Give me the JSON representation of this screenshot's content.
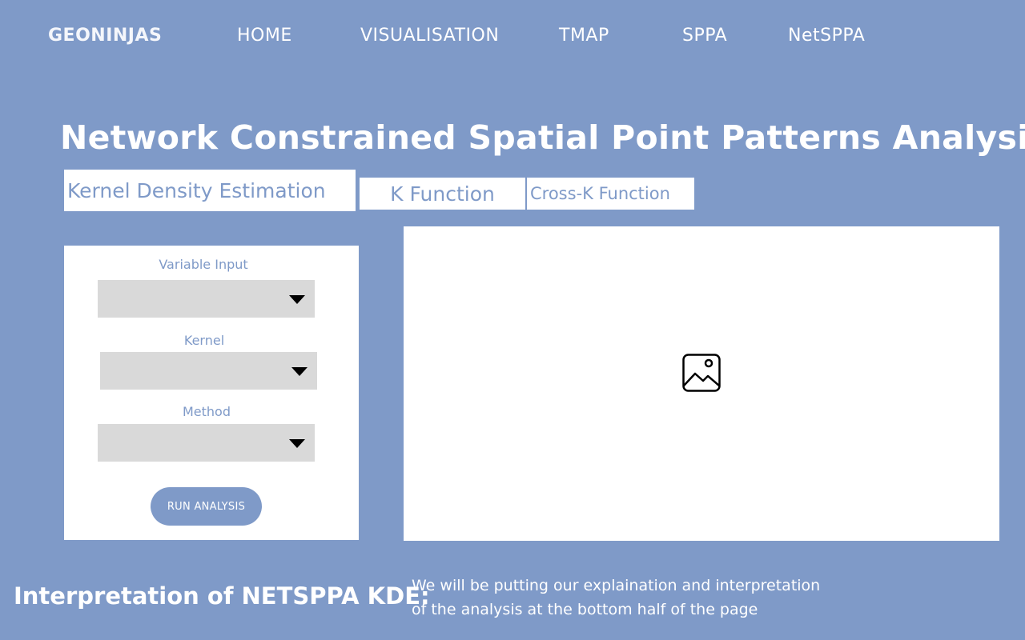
{
  "nav": {
    "brand": "GEONINJAS",
    "items": [
      {
        "label": "HOME"
      },
      {
        "label": "VISUALISATION"
      },
      {
        "label": "TMAP"
      },
      {
        "label": "SPPA"
      },
      {
        "label": "NetSPPA"
      }
    ]
  },
  "page": {
    "title": "Network Constrained Spatial Point Patterns Analysis"
  },
  "tabs": [
    {
      "label": "Kernel Density Estimation",
      "active": true
    },
    {
      "label": "K Function"
    },
    {
      "label": "Cross-K Function"
    }
  ],
  "controls": {
    "variable_input": {
      "label": "Variable Input",
      "value": ""
    },
    "kernel": {
      "label": "Kernel",
      "value": ""
    },
    "method": {
      "label": "Method",
      "value": ""
    },
    "run_button": "RUN ANALYSIS"
  },
  "visualization": {
    "icon": "image-placeholder-icon"
  },
  "interpretation": {
    "title": "Interpretation of NETSPPA KDE:",
    "line1": "We will be putting our explaination and interpretation",
    "line2": "of the analysis at the bottom half of the page"
  },
  "colors": {
    "background": "#7f9ac8",
    "panel": "#ffffff",
    "select": "#d9d9d9",
    "accent_text": "#7f9ac8"
  }
}
